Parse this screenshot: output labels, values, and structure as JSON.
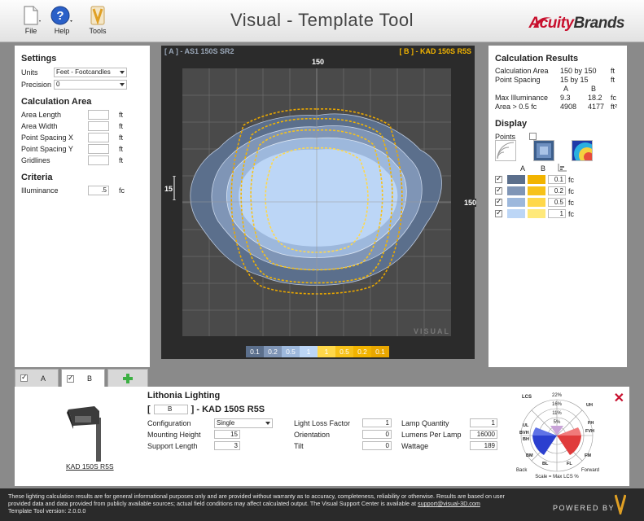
{
  "toolbar": {
    "file_label": "File",
    "help_label": "Help",
    "tools_label": "Tools"
  },
  "app": {
    "title": "Visual - Template Tool",
    "logo_text_a": "Acuity",
    "logo_text_b": "Brands"
  },
  "settings": {
    "heading": "Settings",
    "units_label": "Units",
    "units_value": "Feet - Footcandles",
    "precision_label": "Precision",
    "precision_value": "0"
  },
  "calc_area": {
    "heading": "Calculation Area",
    "fields": [
      {
        "label": "Area Length",
        "value": "",
        "unit": "ft"
      },
      {
        "label": "Area Width",
        "value": "",
        "unit": "ft"
      },
      {
        "label": "Point Spacing X",
        "value": "",
        "unit": "ft"
      },
      {
        "label": "Point Spacing Y",
        "value": "",
        "unit": "ft"
      },
      {
        "label": "Gridlines",
        "value": "",
        "unit": "ft"
      }
    ]
  },
  "criteria": {
    "heading": "Criteria",
    "illuminance_label": "Illuminance",
    "illuminance_value": ".5",
    "illuminance_unit": "fc"
  },
  "plot": {
    "label_a": "[ A ] - AS1 150S SR2",
    "label_b": "[ B ] - KAD 150S R5S",
    "top_tick": "150",
    "right_tick": "150",
    "left_tick": "15",
    "watermark": "VISUAL",
    "legend": [
      {
        "text": "0.1",
        "bg": "#5b6f8c",
        "fg": "#ffffff"
      },
      {
        "text": "0.2",
        "bg": "#7f95b6",
        "fg": "#ffffff"
      },
      {
        "text": "0.5",
        "bg": "#9db8dc",
        "fg": "#ffffff"
      },
      {
        "text": "1",
        "bg": "#bcd6f6",
        "fg": "#ffffff"
      },
      {
        "text": "1",
        "bg": "#ffd84a",
        "fg": "#ffffff"
      },
      {
        "text": "0.5",
        "bg": "#f7c21a",
        "fg": "#ffffff"
      },
      {
        "text": "0.2",
        "bg": "#f2b400",
        "fg": "#ffffff"
      },
      {
        "text": "0.1",
        "bg": "#e9a700",
        "fg": "#ffffff"
      }
    ]
  },
  "results": {
    "heading": "Calculation Results",
    "calc_area_label": "Calculation Area",
    "calc_area_value": "150 by 150",
    "calc_area_unit": "ft",
    "spacing_label": "Point Spacing",
    "spacing_value": "15 by 15",
    "spacing_unit": "ft",
    "col_a": "A",
    "col_b": "B",
    "max_label": "Max Illuminance",
    "max_a": "9.3",
    "max_b": "18.2",
    "max_unit": "fc",
    "area_label": "Area > 0.5 fc",
    "area_a": "4908",
    "area_b": "4177",
    "area_unit": "ft²"
  },
  "display": {
    "heading": "Display",
    "points_label": "Points",
    "col_a": "A",
    "col_b": "B",
    "levels": [
      {
        "value": "0.1",
        "unit": "fc",
        "a": "#5b6f8c",
        "b": "#f2b400"
      },
      {
        "value": "0.2",
        "unit": "fc",
        "a": "#7f95b6",
        "b": "#f7c21a"
      },
      {
        "value": "0.5",
        "unit": "fc",
        "a": "#9db8dc",
        "b": "#ffd84a"
      },
      {
        "value": "1",
        "unit": "fc",
        "a": "#bcd6f6",
        "b": "#ffe97a"
      }
    ]
  },
  "tabs": [
    {
      "label": "A"
    },
    {
      "label": "B"
    }
  ],
  "luminaire": {
    "manufacturer": "Lithonia Lighting",
    "bracket_open": "[",
    "id_value": "B",
    "title_suffix": "] - KAD 150S R5S",
    "image_caption": "KAD 150S R5S",
    "configuration_label": "Configuration",
    "configuration_value": "Single",
    "mounting_label": "Mounting Height",
    "mounting_value": "15",
    "support_label": "Support Length",
    "support_value": "3",
    "llf_label": "Light Loss Factor",
    "llf_value": "1",
    "orientation_label": "Orientation",
    "orientation_value": "0",
    "tilt_label": "Tilt",
    "tilt_value": "0",
    "lamp_qty_label": "Lamp Quantity",
    "lamp_qty_value": "1",
    "lumens_label": "Lumens Per Lamp",
    "lumens_value": "16000",
    "wattage_label": "Wattage",
    "wattage_value": "189"
  },
  "bug_chart": {
    "pct": [
      "22%",
      "16%",
      "11%",
      "5%"
    ],
    "labels": {
      "lcs": "LCS",
      "uh": "UH",
      "ul": "UL",
      "bvh": "BVH",
      "bh": "BH",
      "fvh": "FVH",
      "fh": "FH",
      "bm": "BM",
      "fm": "FM",
      "bl": "BL",
      "fl": "FL",
      "back": "Back",
      "forward": "Forward"
    },
    "scale_caption": "Scale = Max LCS %"
  },
  "footer": {
    "line1": "These lighting calculation results are for general informational purposes only and are provided without warranty as to accuracy, completeness, reliability or otherwise. Results are based on user",
    "line2": "provided data and data provided from publicly available sources; actual field conditions may affect calculated output. The Visual Support Center is available at",
    "email": "support@visual-3D.com",
    "line3": "Template Tool version: 2.0.0.0",
    "powered": "POWERED BY"
  }
}
